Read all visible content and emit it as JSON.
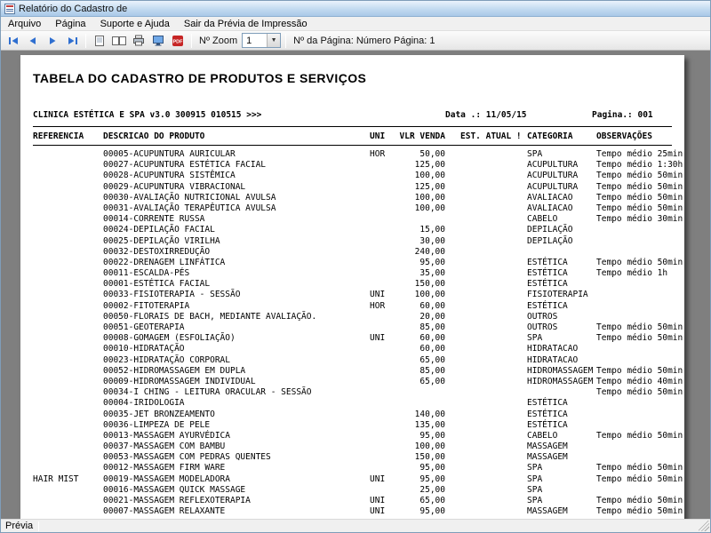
{
  "window": {
    "title": "Relatório do Cadastro de",
    "status": "Prévia"
  },
  "menu": {
    "items": [
      "Arquivo",
      "Página",
      "Suporte e Ajuda",
      "Sair da Prévia de Impressão"
    ]
  },
  "toolbar": {
    "zoom_label": "Nº Zoom",
    "zoom_value": "1",
    "page_info": "Nº da Página: Número Página: 1",
    "icons": [
      "first-page-icon",
      "previous-page-icon",
      "next-page-icon",
      "last-page-icon",
      "single-page-icon",
      "two-page-icon",
      "printer-icon",
      "screen-view-icon",
      "pdf-export-icon",
      "dropdown-arrow-icon"
    ],
    "accent_color": "#2f6fd0",
    "pdf_color": "#c62424"
  },
  "report": {
    "title": "TABELA DO CADASTRO DE PRODUTOS E SERVIÇOS",
    "clinic_line": "CLINICA ESTÉTICA E SPA v3.0 300915 010515 >>>",
    "date_label": "Data .: 11/05/15",
    "page_label": "Pagina.: 001",
    "columns": [
      "REFERENCIA",
      "DESCRICAO DO PRODUTO",
      "UNI",
      "VLR VENDA",
      "EST. ATUAL !",
      "CATEGORIA",
      "OBSERVAÇÕES"
    ],
    "rows": [
      {
        "desc": "00005-ACUPUNTURA AURICULAR",
        "uni": "HOR",
        "vlr": "50,00",
        "cat": "SPA",
        "obs": "Tempo médio 25min"
      },
      {
        "desc": "00027-ACUPUNTURA ESTÉTICA FACIAL",
        "vlr": "125,00",
        "cat": "ACUPULTURA",
        "obs": "Tempo médio 1:30h"
      },
      {
        "desc": "00028-ACUPUNTURA SISTÊMICA",
        "vlr": "100,00",
        "cat": "ACUPULTURA",
        "obs": "Tempo médio 50min"
      },
      {
        "desc": "00029-ACUPUNTURA VIBRACIONAL",
        "vlr": "125,00",
        "cat": "ACUPULTURA",
        "obs": "Tempo médio 50min"
      },
      {
        "desc": "00030-AVALIAÇÃO NUTRICIONAL AVULSA",
        "vlr": "100,00",
        "cat": "AVALIACAO",
        "obs": "Tempo médio 50min"
      },
      {
        "desc": "00031-AVALIAÇÃO TERAPÊUTICA AVULSA",
        "vlr": "100,00",
        "cat": "AVALIACAO",
        "obs": "Tempo médio 50min"
      },
      {
        "desc": "00014-CORRENTE RUSSA",
        "cat": "CABELO",
        "obs": "Tempo médio 30min"
      },
      {
        "desc": "00024-DEPILAÇÃO FACIAL",
        "vlr": "15,00",
        "cat": "DEPILAÇÃO"
      },
      {
        "desc": "00025-DEPILAÇÃO VIRILHA",
        "vlr": "30,00",
        "cat": "DEPILAÇÃO"
      },
      {
        "desc": "00032-DESTOXIRREDUÇÃO",
        "vlr": "240,00"
      },
      {
        "desc": "00022-DRENAGEM LINFÁTICA",
        "vlr": "95,00",
        "cat": "ESTÉTICA",
        "obs": "Tempo médio 50min"
      },
      {
        "desc": "00011-ESCALDA-PÉS",
        "vlr": "35,00",
        "cat": "ESTÉTICA",
        "obs": "Tempo médio 1h"
      },
      {
        "desc": "00001-ESTÉTICA FACIAL",
        "vlr": "150,00",
        "cat": "ESTÉTICA"
      },
      {
        "desc": "00033-FISIOTERAPIA - SESSÃO",
        "uni": "UNI",
        "vlr": "100,00",
        "cat": "FISIOTERAPIA"
      },
      {
        "desc": "00002-FITOTERAPIA",
        "uni": "HOR",
        "vlr": "60,00",
        "cat": "ESTÉTICA"
      },
      {
        "desc": "00050-FLORAIS DE BACH, MEDIANTE AVALIAÇÃO.",
        "vlr": "20,00",
        "cat": "OUTROS"
      },
      {
        "desc": "00051-GEOTERAPIA",
        "vlr": "85,00",
        "cat": "OUTROS",
        "obs": "Tempo médio 50min"
      },
      {
        "desc": "00008-GOMAGEM (ESFOLIAÇÃO)",
        "uni": "UNI",
        "vlr": "60,00",
        "cat": "SPA",
        "obs": "Tempo médio 50min"
      },
      {
        "desc": "00010-HIDRATAÇÃO",
        "vlr": "60,00",
        "cat": "HIDRATACAO"
      },
      {
        "desc": "00023-HIDRATAÇÃO CORPORAL",
        "vlr": "65,00",
        "cat": "HIDRATACAO"
      },
      {
        "desc": "00052-HIDROMASSAGEM EM DUPLA",
        "vlr": "85,00",
        "cat": "HIDROMASSAGEM",
        "obs": "Tempo médio 50min"
      },
      {
        "desc": "00009-HIDROMASSAGEM INDIVIDUAL",
        "vlr": "65,00",
        "cat": "HIDROMASSAGEM",
        "obs": "Tempo médio 40min"
      },
      {
        "desc": "00034-I CHING - LEITURA ORACULAR - SESSÃO",
        "obs": "Tempo médio 50min"
      },
      {
        "desc": "00004-IRIDOLOGIA",
        "cat": "ESTÉTICA"
      },
      {
        "desc": "00035-JET BRONZEAMENTO",
        "vlr": "140,00",
        "cat": "ESTÉTICA"
      },
      {
        "desc": "00036-LIMPEZA DE PELE",
        "vlr": "135,00",
        "cat": "ESTÉTICA"
      },
      {
        "desc": "00013-MASSAGEM AYURVÉDICA",
        "vlr": "95,00",
        "cat": "CABELO",
        "obs": "Tempo médio 50min"
      },
      {
        "desc": "00037-MASSAGEM COM BAMBU",
        "vlr": "100,00",
        "cat": "MASSAGEM"
      },
      {
        "desc": "00053-MASSAGEM COM PEDRAS QUENTES",
        "vlr": "150,00",
        "cat": "MASSAGEM"
      },
      {
        "desc": "00012-MASSAGEM FIRM WARE",
        "vlr": "95,00",
        "cat": "SPA",
        "obs": "Tempo médio 50min"
      },
      {
        "ref": "HAIR MIST",
        "desc": "00019-MASSAGEM MODELADORA",
        "uni": "UNI",
        "vlr": "95,00",
        "cat": "SPA",
        "obs": "Tempo médio 50min"
      },
      {
        "desc": "00016-MASSAGEM QUICK MASSAGE",
        "vlr": "25,00",
        "cat": "SPA"
      },
      {
        "desc": "00021-MASSAGEM REFLEXOTERAPIA",
        "uni": "UNI",
        "vlr": "65,00",
        "cat": "SPA",
        "obs": "Tempo médio 50min"
      },
      {
        "desc": "00007-MASSAGEM RELAXANTE",
        "uni": "UNI",
        "vlr": "95,00",
        "cat": "MASSAGEM",
        "obs": "Tempo médio 50min"
      }
    ]
  }
}
